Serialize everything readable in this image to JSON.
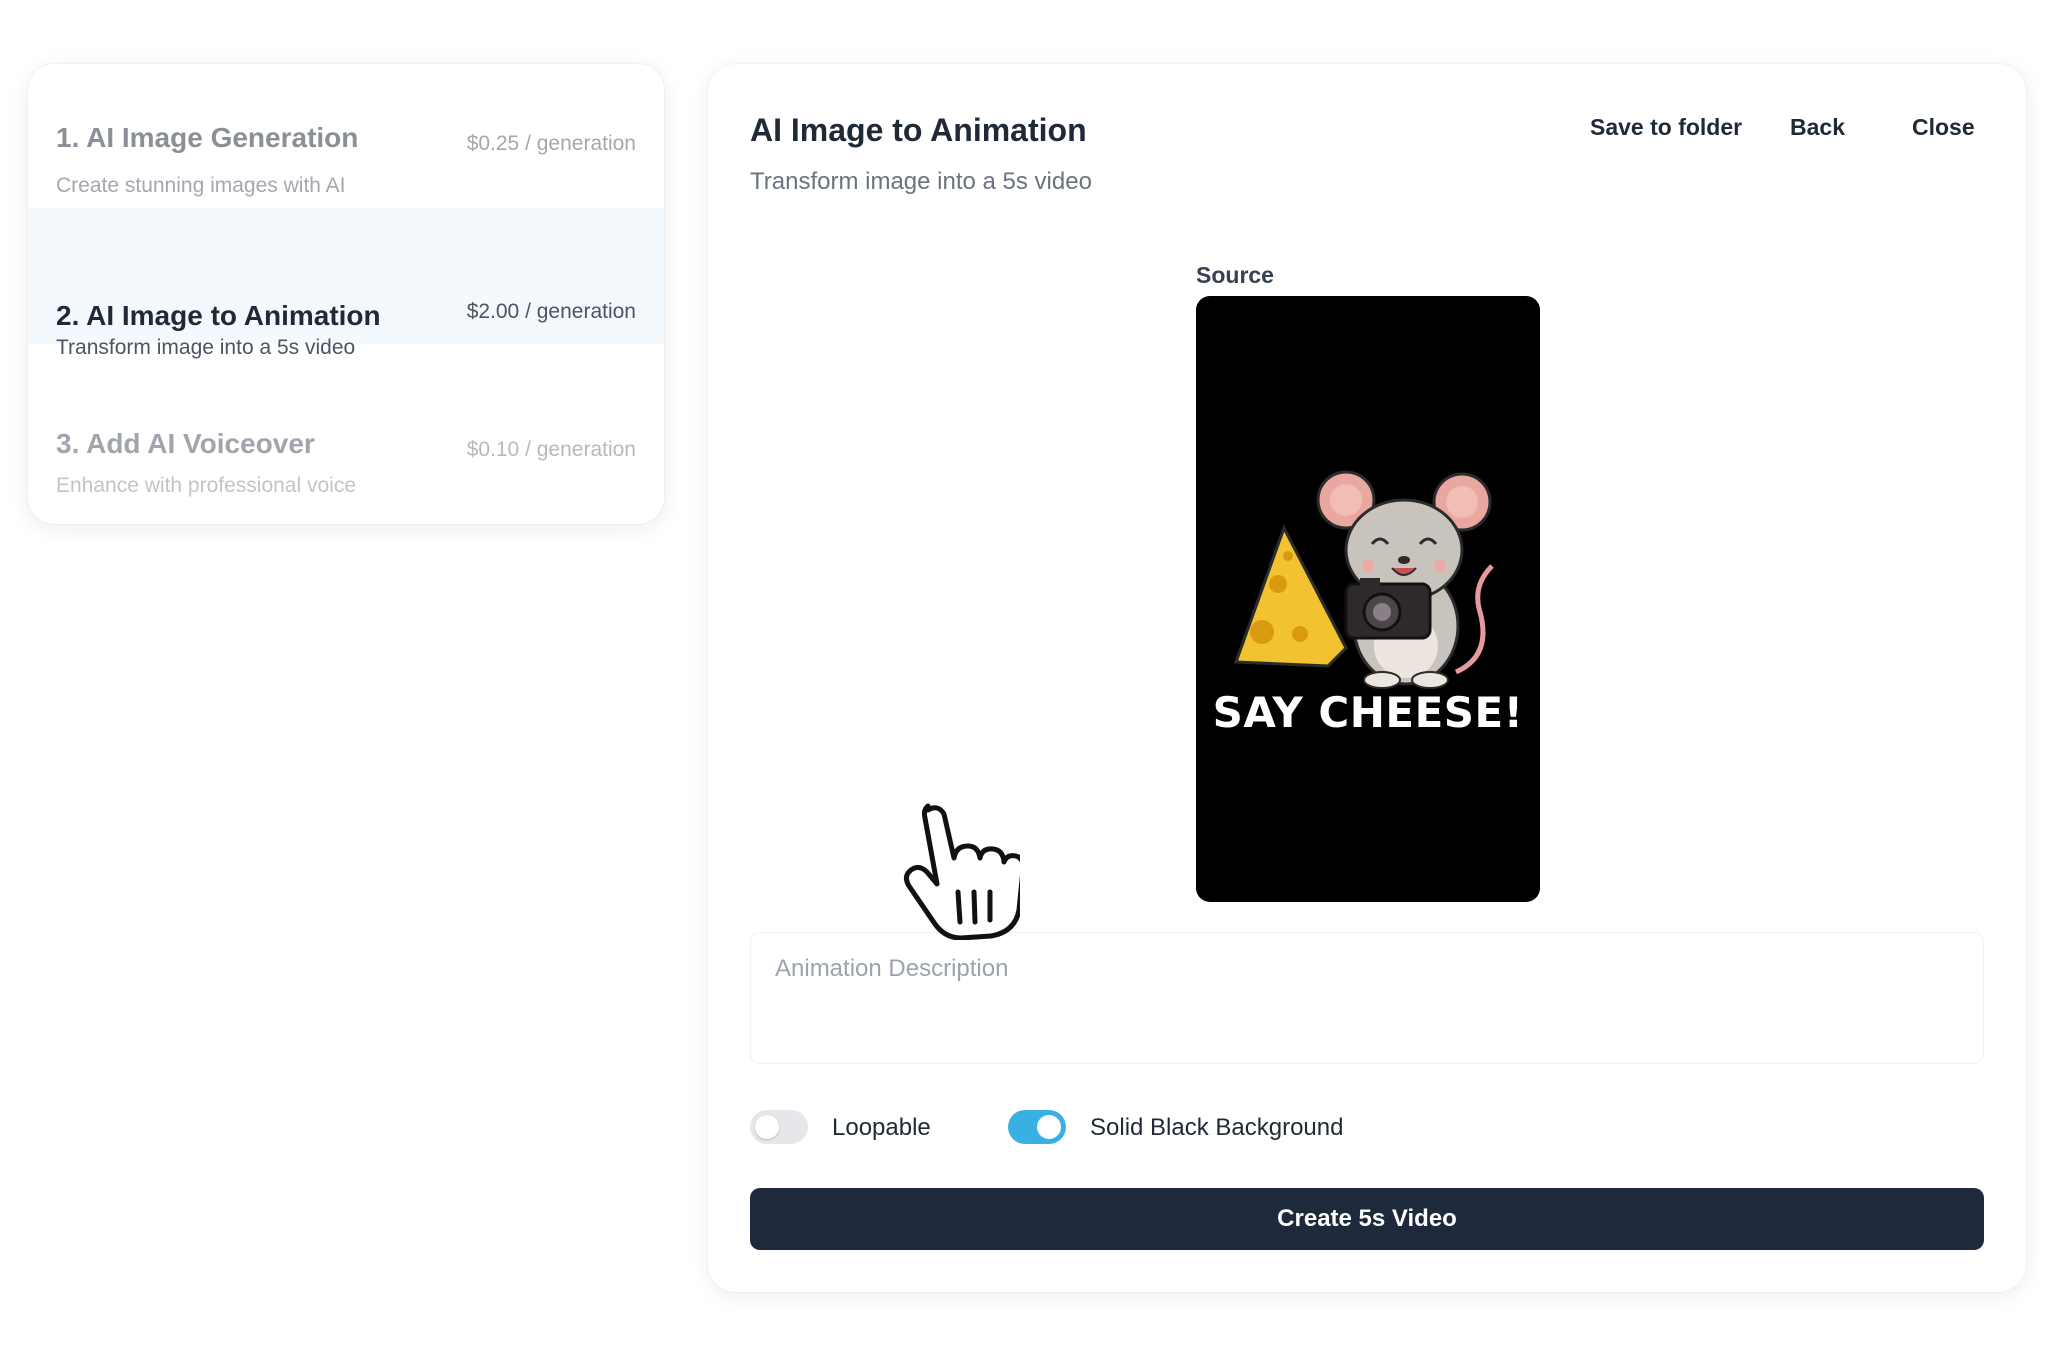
{
  "steps": [
    {
      "title": "1. AI Image Generation",
      "price": "$0.25 / generation",
      "desc": "Create stunning images with AI"
    },
    {
      "title": "2. AI Image to Animation",
      "price": "$2.00 / generation",
      "desc": "Transform image into a 5s video"
    },
    {
      "title": "3. Add AI Voiceover",
      "price": "$0.10 / generation",
      "desc": "Enhance with professional voice"
    }
  ],
  "main": {
    "title": "AI Image to Animation",
    "subtitle": "Transform image into a 5s video",
    "save_label": "Save to folder",
    "back_label": "Back",
    "close_label": "Close",
    "source_label": "Source",
    "image_caption": "SAY CHEESE!",
    "desc_placeholder": "Animation Description",
    "toggles": {
      "loopable": {
        "label": "Loopable",
        "on": false
      },
      "solid_black": {
        "label": "Solid Black Background",
        "on": true
      }
    },
    "create_label": "Create 5s Video"
  },
  "colors": {
    "accent": "#3ab0e2",
    "button_dark": "#1e293b",
    "selected_bg": "#f4f9fd"
  }
}
